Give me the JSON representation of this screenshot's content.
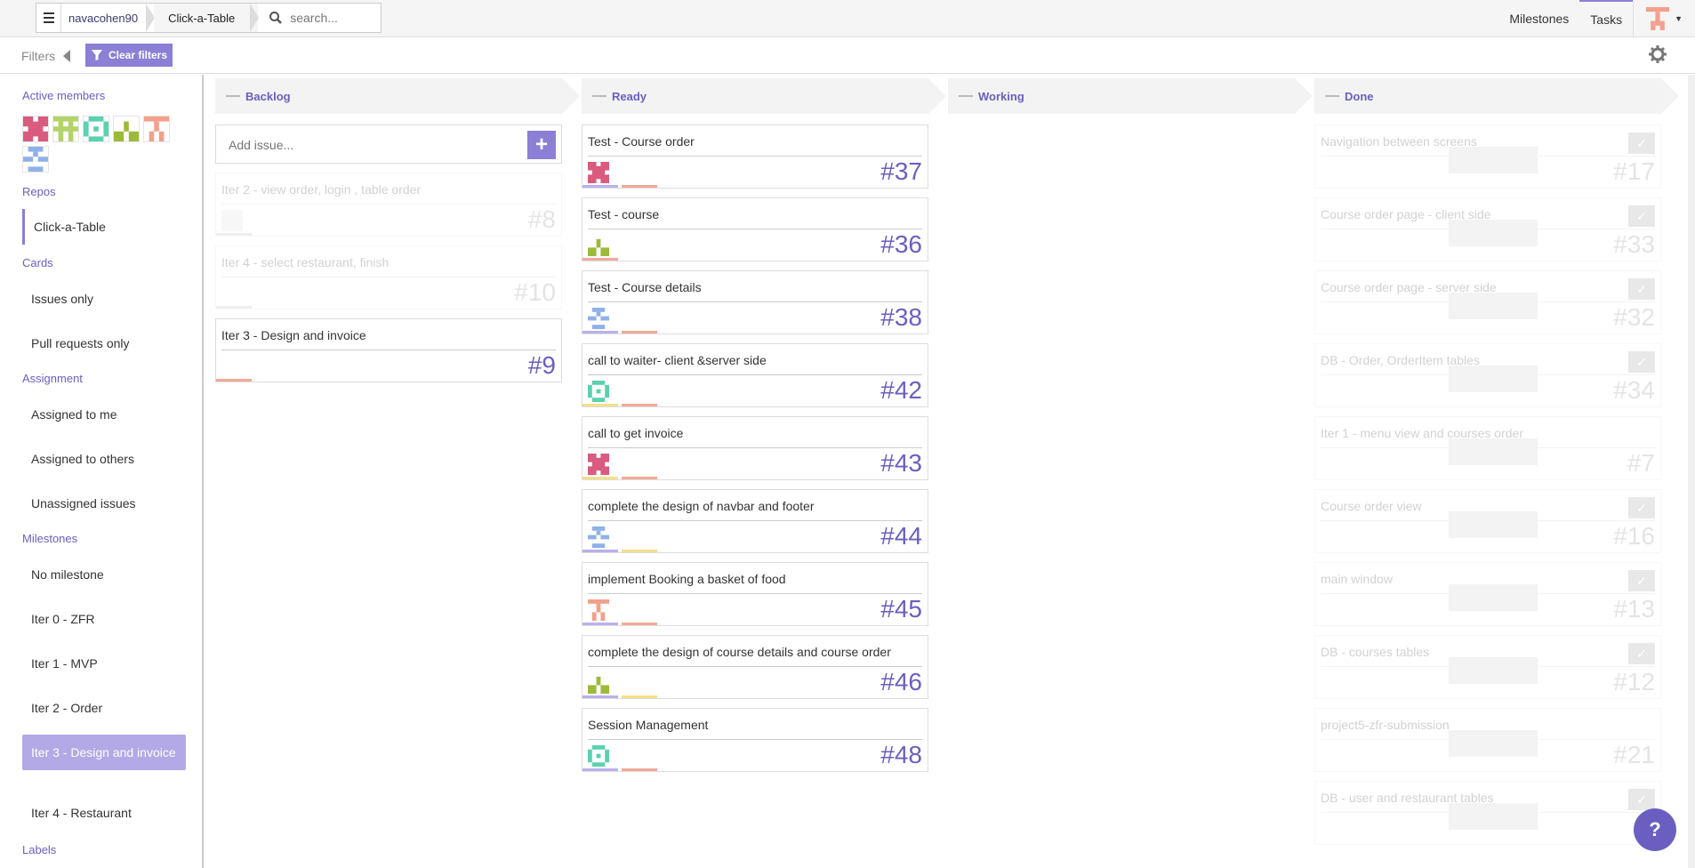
{
  "topbar": {
    "user": "navacohen90",
    "repo": "Click-a-Table",
    "search_placeholder": "search...",
    "nav": [
      "Milestones",
      "Tasks"
    ]
  },
  "filterbar": {
    "filters_label": "Filters",
    "clear_label": "Clear filters"
  },
  "sidebar": {
    "active_members_title": "Active members",
    "repos_title": "Repos",
    "repo": "Click-a-Table",
    "cards_title": "Cards",
    "cards": [
      "Issues only",
      "Pull requests only"
    ],
    "assignment_title": "Assignment",
    "assignment": [
      "Assigned to me",
      "Assigned to others",
      "Unassigned issues"
    ],
    "milestones_title": "Milestones",
    "milestones": [
      "No milestone",
      "Iter 0 - ZFR",
      "Iter 1 - MVP",
      "Iter 2 - Order",
      "Iter 3 - Design and invoice",
      "Iter 4 - Restaurant"
    ],
    "labels_title": "Labels"
  },
  "columns": {
    "backlog": "Backlog",
    "ready": "Ready",
    "working": "Working",
    "done": "Done"
  },
  "backlog": {
    "add_placeholder": "Add issue...",
    "cards": [
      {
        "title": "Iter 2 - view order, login , table order",
        "num": "#8"
      },
      {
        "title": "Iter 4 - select restaurant, finish",
        "num": "#10"
      },
      {
        "title": "Iter 3 - Design and invoice",
        "num": "#9"
      }
    ]
  },
  "ready": {
    "cards": [
      {
        "title": "Test - Course order",
        "num": "#37"
      },
      {
        "title": "Test - course",
        "num": "#36"
      },
      {
        "title": "Test - Course details",
        "num": "#38"
      },
      {
        "title": "call to waiter- client &server side",
        "num": "#42"
      },
      {
        "title": "call to get invoice",
        "num": "#43"
      },
      {
        "title": "complete the design of navbar and footer",
        "num": "#44"
      },
      {
        "title": "implement Booking a basket of food",
        "num": "#45"
      },
      {
        "title": "complete the design of course details and course order",
        "num": "#46"
      },
      {
        "title": "Session Management",
        "num": "#48"
      }
    ]
  },
  "done": {
    "cards": [
      {
        "title": "Navigation between screens",
        "num": "#17"
      },
      {
        "title": "Course order page - client side",
        "num": "#33"
      },
      {
        "title": "Course order page - server side",
        "num": "#32"
      },
      {
        "title": "DB - Order, OrderItem tables",
        "num": "#34"
      },
      {
        "title": "Iter 1 - menu view and courses order",
        "num": "#7"
      },
      {
        "title": "Course order view",
        "num": "#16"
      },
      {
        "title": "main window",
        "num": "#13"
      },
      {
        "title": "DB - courses tables",
        "num": "#12"
      },
      {
        "title": "project5-zfr-submission",
        "num": "#21"
      },
      {
        "title": "DB - user and restaurant tables",
        "num": ""
      }
    ]
  },
  "colors": {
    "accent": "#8b7fd6",
    "accent_dark": "#6a5fc1",
    "label_red": "#f0a99a",
    "label_purple": "#b9b0ee",
    "label_yellow": "#f3e08a"
  }
}
